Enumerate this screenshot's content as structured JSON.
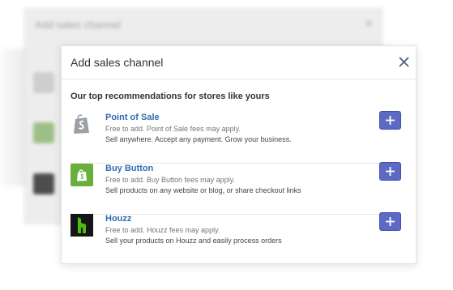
{
  "background_dialog": {
    "title": "Add sales channel"
  },
  "modal": {
    "title": "Add sales channel",
    "section_heading": "Our top recommendations for stores like yours",
    "channels": [
      {
        "name": "Point of Sale",
        "line1": "Free to add. Point of Sale fees may apply.",
        "line2": "Sell anywhere. Accept any payment. Grow your business.",
        "icon": "shopify-bag-icon"
      },
      {
        "name": "Buy Button",
        "line1": "Free to add. Buy Button fees may apply.",
        "line2": "Sell products on any website or blog, or share checkout links",
        "icon": "buy-button-icon"
      },
      {
        "name": "Houzz",
        "line1": "Free to add. Houzz fees may apply.",
        "line2": "Sell your products on Houzz and easily process orders",
        "icon": "houzz-icon"
      }
    ]
  },
  "colors": {
    "accent": "#5c6ac4",
    "link": "#2f6db3",
    "buy_button_green": "#6aaf3d",
    "houzz_green": "#4dbc15"
  }
}
